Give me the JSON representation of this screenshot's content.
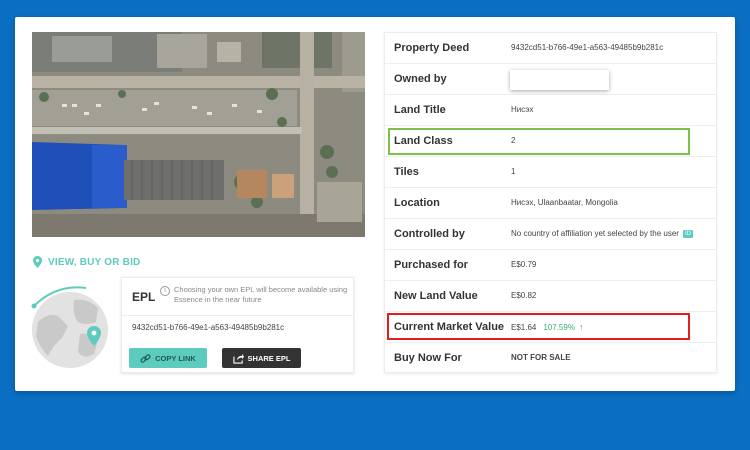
{
  "colors": {
    "accent": "#5ecbbf",
    "highlight_green": "#7cc24a",
    "highlight_red": "#e02020",
    "background": "#0a6fc2"
  },
  "left": {
    "view_buy_bid_label": "VIEW, BUY OR BID",
    "epl": {
      "title": "EPL",
      "note": "Choosing your own EPL will become available using Essence in the near future",
      "hash": "9432cd51-b766-49e1-a563-49485b9b281c",
      "copy_label": "COPY LINK",
      "share_label": "SHARE EPL"
    }
  },
  "details": {
    "rows": [
      {
        "label": "Property Deed",
        "value": "9432cd51-b766-49e1-a563-49485b9b281c"
      },
      {
        "label": "Owned by",
        "value": ""
      },
      {
        "label": "Land Title",
        "value": "Нисэх"
      },
      {
        "label": "Land Class",
        "value": "2"
      },
      {
        "label": "Tiles",
        "value": "1"
      },
      {
        "label": "Location",
        "value": "Нисэх, Ulaanbaatar, Mongolia"
      },
      {
        "label": "Controlled by",
        "value": "No country of affiliation yet selected by the user",
        "badge": "ID"
      },
      {
        "label": "Purchased for",
        "value": "E$0.79"
      },
      {
        "label": "New Land Value",
        "value": "E$0.82"
      },
      {
        "label": "Current Market Value",
        "value": "E$1.64",
        "change": "107.59%"
      },
      {
        "label": "Buy Now For",
        "value": "NOT FOR SALE"
      }
    ]
  }
}
